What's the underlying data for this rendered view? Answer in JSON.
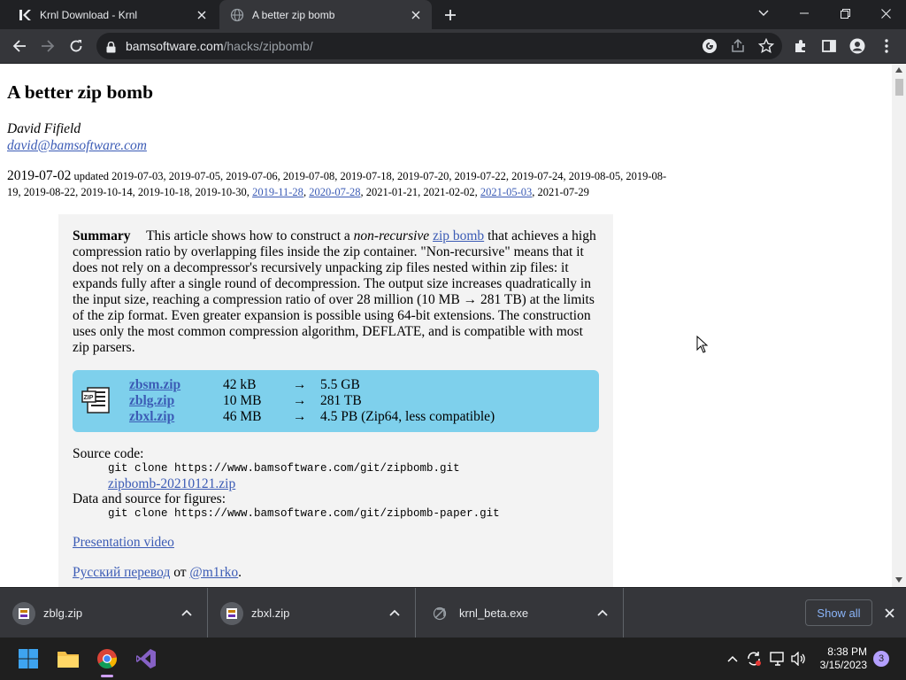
{
  "browser": {
    "tabs": [
      {
        "title": "Krnl Download - Krnl",
        "active": false
      },
      {
        "title": "A better zip bomb",
        "active": true
      }
    ],
    "url_domain": "bamsoftware.com",
    "url_path": "/hacks/zipbomb/"
  },
  "page": {
    "title": "A better zip bomb",
    "author": "David Fifield",
    "email": "david@bamsoftware.com",
    "date_main": "2019-07-02",
    "updated_label": "updated",
    "dates_plain_1": "2019-07-03, 2019-07-05, 2019-07-06, 2019-07-08, 2019-07-18, 2019-07-20, 2019-07-22, 2019-07-24, 2019-08-05, 2019-08-19, 2019-08-22, 2019-10-14, 2019-10-18, 2019-10-30,",
    "date_link_1": "2019-11-28",
    "date_link_2": "2020-07-28",
    "dates_plain_2": ", 2021-01-21, 2021-02-02,",
    "date_link_3": "2021-05-03",
    "dates_plain_3": ", 2021-07-29",
    "summary_label": "Summary",
    "summary_1": "This article shows how to construct a",
    "summary_em": "non-recursive",
    "summary_link": "zip bomb",
    "summary_2": "that achieves a high compression ratio by overlapping files inside the zip container. \"Non-recursive\" means that it does not rely on a decompressor's recursively unpacking zip files nested within zip files: it expands fully after a single round of decompression. The output size increases quadratically in the input size, reaching a compression ratio of over 28 million (10 MB → 281 TB) at the limits of the zip format. Even greater expansion is possible using 64-bit extensions. The construction uses only the most common compression algorithm, DEFLATE, and is compatible with most zip parsers.",
    "files": [
      {
        "name": "zbsm.zip",
        "size": "42 kB",
        "arrow": "→",
        "output": "5.5 GB"
      },
      {
        "name": "zblg.zip",
        "size": "10 MB",
        "arrow": "→",
        "output": "281 TB"
      },
      {
        "name": "zbxl.zip",
        "size": "46 MB",
        "arrow": "→",
        "output": "4.5 PB (Zip64, less compatible)"
      }
    ],
    "source_label": "Source code:",
    "source_cmd": "git clone https://www.bamsoftware.com/git/zipbomb.git",
    "source_zip": "zipbomb-20210121.zip",
    "data_label": "Data and source for figures:",
    "data_cmd": "git clone https://www.bamsoftware.com/git/zipbomb-paper.git",
    "video_link": "Presentation video",
    "ru_link": "Русский перевод",
    "ru_from": "от",
    "ru_author": "@m1rko",
    "ru_end": "."
  },
  "downloads": {
    "items": [
      {
        "name": "zblg.zip"
      },
      {
        "name": "zbxl.zip"
      },
      {
        "name": "krnl_beta.exe"
      }
    ],
    "show_all": "Show all"
  },
  "taskbar": {
    "time": "8:38 PM",
    "date": "3/15/2023",
    "notifications": "3"
  }
}
